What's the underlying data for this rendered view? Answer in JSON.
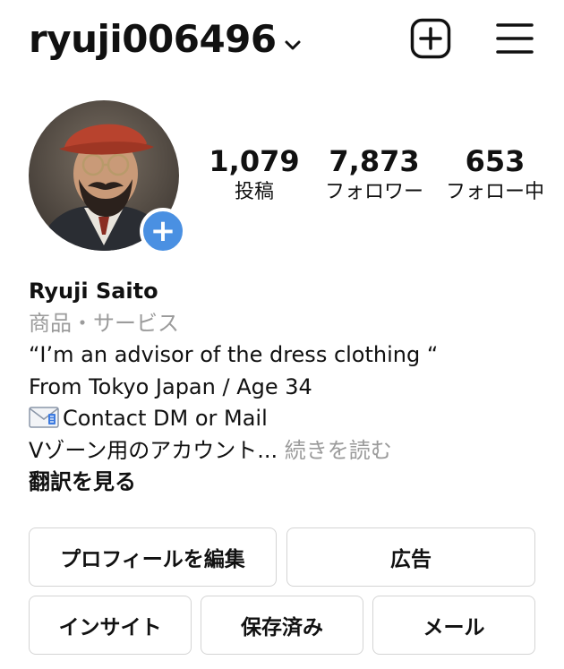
{
  "header": {
    "username": "ryuji006496",
    "icons": {
      "dropdown": "chevron-down-icon",
      "new_post": "plus-square-icon",
      "menu": "hamburger-menu-icon"
    }
  },
  "profile": {
    "avatar_alt": "profile-photo",
    "add_story_symbol": "+",
    "stats": {
      "posts": {
        "value": "1,079",
        "label": "投稿"
      },
      "followers": {
        "value": "7,873",
        "label": "フォロワー"
      },
      "following": {
        "value": "653",
        "label": "フォロー中"
      }
    }
  },
  "bio": {
    "name": "Ryuji Saito",
    "category": "商品・サービス",
    "lines": [
      "“I’m an advisor of the dress clothing “",
      "From Tokyo Japan / Age 34",
      "Contact DM or Mail"
    ],
    "truncated_line": "Vゾーン用のアカウント...",
    "more_label": "続きを読む",
    "translate_label": "翻訳を見る",
    "mail_icon": "envelope-emoji-icon"
  },
  "actions": {
    "edit_profile": "プロフィールを編集",
    "ads": "広告",
    "insights": "インサイト",
    "saved": "保存済み",
    "email": "メール"
  },
  "colors": {
    "accent_blue": "#4a90e2",
    "muted_text": "#9b9b9b",
    "button_border": "#d4d4d4",
    "text": "#111111"
  }
}
